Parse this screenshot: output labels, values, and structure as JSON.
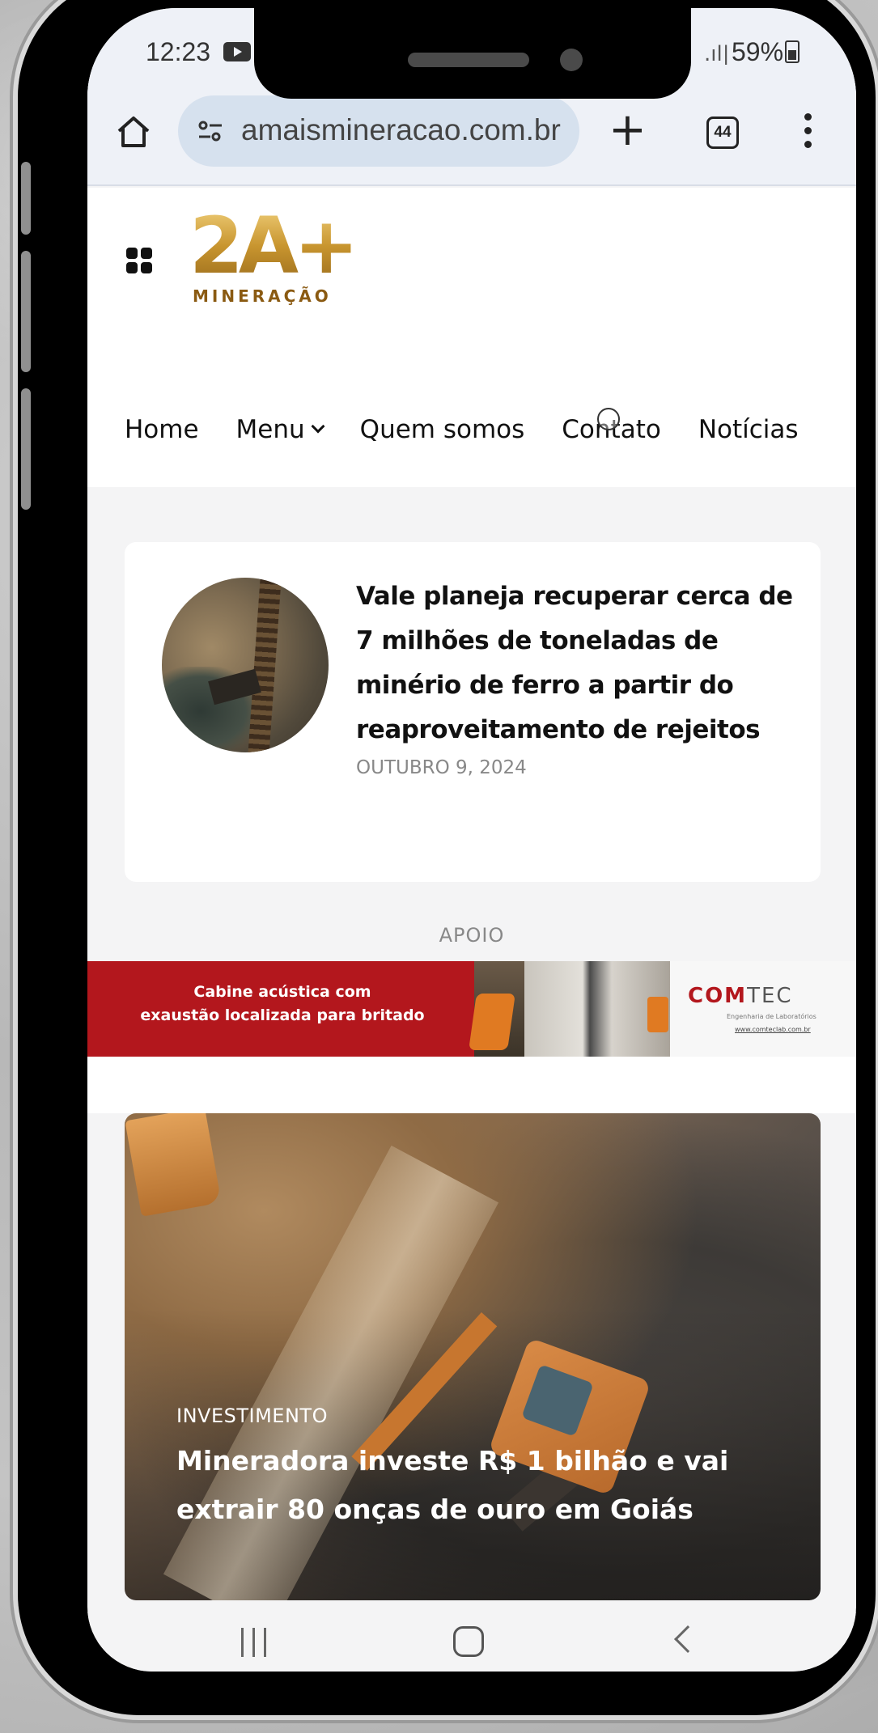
{
  "status_bar": {
    "time": "12:23",
    "battery": "59%"
  },
  "browser": {
    "url": "amaismineracao.com.br",
    "tab_count": "44"
  },
  "site": {
    "logo_main": "2A+",
    "logo_sub": "MINERAÇÃO",
    "nav": [
      "Home",
      "Menu",
      "Quem somos",
      "Contato",
      "Notícias"
    ]
  },
  "article": {
    "title": "Vale planeja recuperar cerca de 7 milhões de toneladas de minério de ferro a partir do reaproveitamento de rejeitos",
    "date": "OUTUBRO 9, 2024"
  },
  "apoio": {
    "label": "APOIO",
    "ad_text_line1": "Cabine acústica com",
    "ad_text_line2": "exaustão localizada para britado",
    "ad_brand_com": "COM",
    "ad_brand_tec": "TEC",
    "ad_subline": "Engenharia de Laboratórios",
    "ad_url": "www.comteclab.com.br"
  },
  "feature": {
    "category": "INVESTIMENTO",
    "title": "Mineradora investe R$ 1 bilhão e vai extrair 80 onças de ouro em Goiás"
  },
  "colors": {
    "logo_gold": "#c99a3a",
    "ad_red": "#b3171d",
    "url_pill": "#d6e1ee"
  },
  "icons": [
    "youtube-icon",
    "signal-icon",
    "battery-icon",
    "home-icon",
    "tune-icon",
    "plus-icon",
    "tabs-icon",
    "kebab-menu-icon",
    "grid-menu-icon",
    "chevron-down-icon",
    "recents-icon",
    "home-button-icon",
    "back-icon"
  ]
}
